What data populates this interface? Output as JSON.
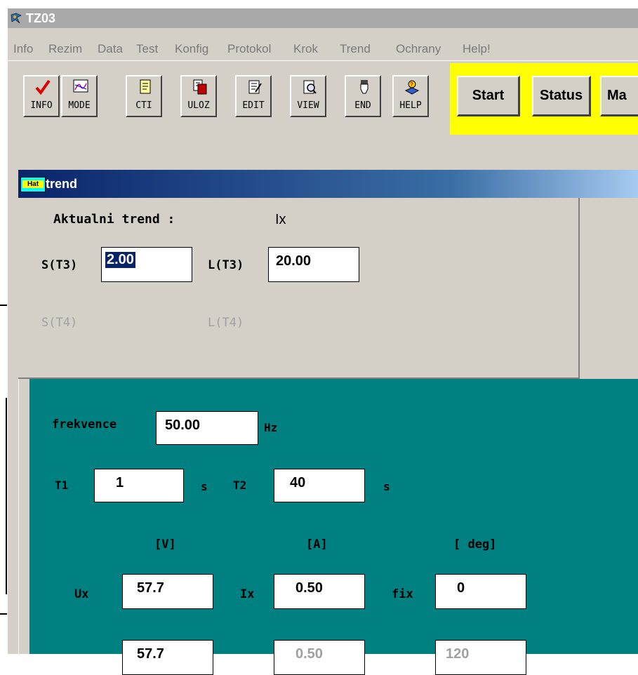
{
  "window": {
    "title": "TZ03",
    "icon": "app-icon"
  },
  "menu": [
    "Info",
    "Rezim",
    "Data",
    "Test",
    "Konfig",
    "Protokol",
    "Krok",
    "Trend",
    "Ochrany",
    "Help!"
  ],
  "toolbar": {
    "buttons": [
      {
        "label": "INFO",
        "icon": "checkmark-icon"
      },
      {
        "label": "MODE",
        "icon": "chart-icon"
      },
      {
        "label": "CTI",
        "icon": "read-doc-icon"
      },
      {
        "label": "ULOZ",
        "icon": "save-doc-icon"
      },
      {
        "label": "EDIT",
        "icon": "edit-doc-icon"
      },
      {
        "label": "VIEW",
        "icon": "view-doc-icon"
      },
      {
        "label": "END",
        "icon": "hand-icon"
      },
      {
        "label": "HELP",
        "icon": "help-icon"
      }
    ],
    "start_label": "Start",
    "status_label": "Status",
    "third_label": "Ma"
  },
  "trend_window": {
    "title": "trend",
    "icon_text": "Hat",
    "current_trend_label": "Aktualni trend :",
    "current_trend_value": "Ix",
    "s_t3_label": "S(T3)",
    "s_t3_value": "2.00",
    "l_t3_label": "L(T3)",
    "l_t3_value": "20.00",
    "s_t4_label": "S(T4)",
    "l_t4_label": "L(T4)"
  },
  "params": {
    "frekvence_label": "frekvence",
    "frekvence_value": "50.00",
    "frekvence_unit": "Hz",
    "t1_label": "T1",
    "t1_value": "1",
    "t1_unit": "s",
    "t2_label": "T2",
    "t2_value": "40",
    "t2_unit": "s",
    "unit_v": "[V]",
    "unit_a": "[A]",
    "unit_deg": "[ deg]",
    "ux_label": "Ux",
    "ux_value": "57.7",
    "ix_label": "Ix",
    "ix_value": "0.50",
    "fix_label": "fix",
    "fix_value": "0",
    "row2_u": "57.7",
    "row2_i": "0.50",
    "row2_f": "120"
  },
  "colors": {
    "teal": "#008080",
    "yellow": "#ffff00",
    "selection": "#0a246a"
  }
}
